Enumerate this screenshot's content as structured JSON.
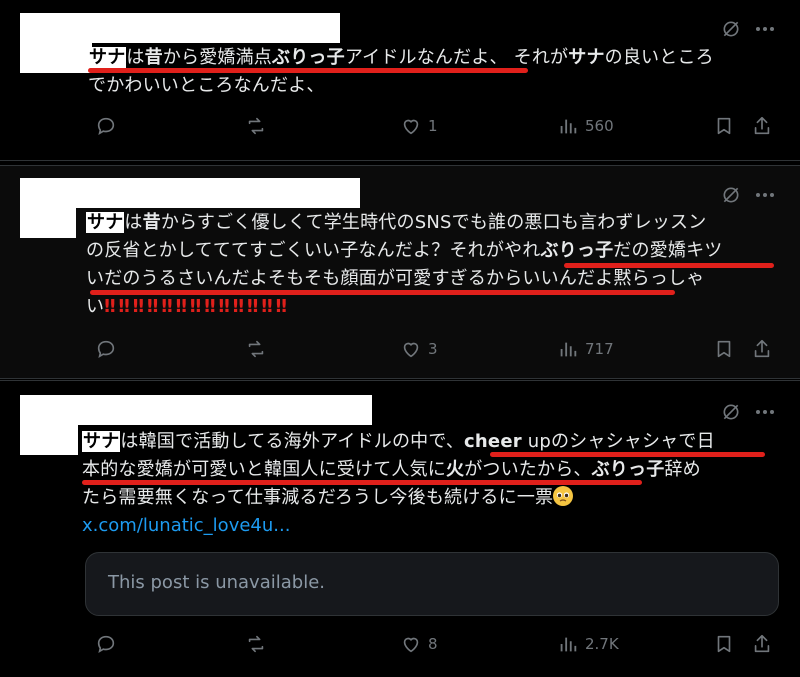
{
  "posts": [
    {
      "lines": [
        {
          "parts": [
            {
              "t": "サナ",
              "hl": true
            },
            {
              "t": "は"
            },
            {
              "t": "昔",
              "b": true
            },
            {
              "t": "から愛嬌満点"
            },
            {
              "t": "ぶりっ子",
              "b": true
            },
            {
              "t": "アイドルなんだよ、 それが"
            },
            {
              "t": "サナ",
              "b": true
            },
            {
              "t": "の良いところ"
            }
          ]
        },
        {
          "parts": [
            {
              "t": "でかわいいところなんだよ、"
            }
          ]
        }
      ],
      "stats": {
        "replies": "",
        "reposts": "",
        "likes": "1",
        "views": "560"
      }
    },
    {
      "lines": [
        {
          "parts": [
            {
              "t": "サナ",
              "hl": true
            },
            {
              "t": "は"
            },
            {
              "t": "昔",
              "b": true
            },
            {
              "t": "からすごく優しくて学生時代のSNSでも誰の悪口も言わずレッスン"
            }
          ]
        },
        {
          "parts": [
            {
              "t": "の反省とかしてててすごくいい子なんだよ？それがやれ"
            },
            {
              "t": "ぶりっ子",
              "b": true
            },
            {
              "t": "だの愛嬌キツ"
            }
          ]
        },
        {
          "parts": [
            {
              "t": "いだのうるさいんだよそもそも顔面が可愛すぎるからいいんだよ黙らっしゃ"
            }
          ]
        },
        {
          "parts": [
            {
              "t": "い"
            },
            {
              "t": "‼︎‼︎‼︎‼︎‼︎‼︎‼︎‼︎‼︎‼︎‼︎‼︎‼︎",
              "bang": true
            }
          ]
        }
      ],
      "stats": {
        "replies": "",
        "reposts": "",
        "likes": "3",
        "views": "717"
      }
    },
    {
      "lines": [
        {
          "parts": [
            {
              "t": "サナ",
              "hl": true
            },
            {
              "t": "は韓国で活動してる海外アイドルの中で、"
            },
            {
              "t": "cheer",
              "b": true
            },
            {
              "t": " upのシャシャシャで日"
            }
          ]
        },
        {
          "parts": [
            {
              "t": "本的な愛嬌が可愛いと韓国人に受けて人気に"
            },
            {
              "t": "火",
              "b": true
            },
            {
              "t": "がついたから、"
            },
            {
              "t": "ぶりっ子",
              "b": true
            },
            {
              "t": "辞め"
            }
          ]
        },
        {
          "parts": [
            {
              "t": "たら需要無くなって仕事減るだろうし今後も続けるに一票"
            },
            {
              "emoji": "pleading-face"
            }
          ]
        }
      ],
      "link": "x.com/lunatic_love4u...",
      "quote_unavailable": "This post is unavailable.",
      "stats": {
        "replies": "",
        "reposts": "",
        "likes": "8",
        "views": "2.7K"
      }
    }
  ],
  "colors": {
    "accent": "#1d9bf0",
    "underline": "#e0201b",
    "muted": "#71767b"
  }
}
